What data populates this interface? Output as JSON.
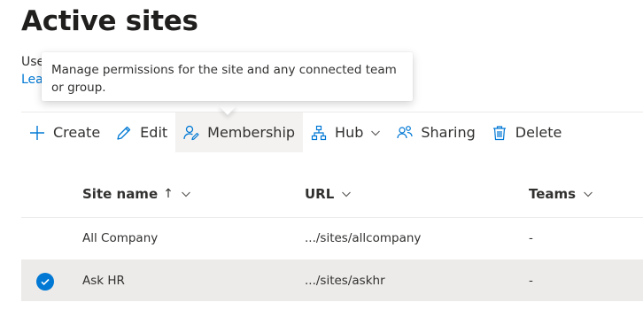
{
  "page": {
    "title": "Active sites"
  },
  "description": {
    "line1": "Use",
    "line2": "Lea"
  },
  "tooltip": {
    "text": "Manage permissions for the site and any connected team or group."
  },
  "commands": {
    "create": "Create",
    "edit": "Edit",
    "membership": "Membership",
    "hub": "Hub",
    "sharing": "Sharing",
    "delete": "Delete"
  },
  "table": {
    "columns": {
      "site_name": "Site name",
      "sort_arrow": "↑",
      "url": "URL",
      "teams": "Teams"
    },
    "rows": [
      {
        "site_name": "All Company",
        "url": ".../sites/allcompany",
        "teams": "-",
        "selected": false
      },
      {
        "site_name": "Ask HR",
        "url": ".../sites/askhr",
        "teams": "-",
        "selected": true
      }
    ]
  },
  "colors": {
    "accent": "#0078d4",
    "selected_row": "#edebe9",
    "active_command": "#f3f2f1"
  }
}
